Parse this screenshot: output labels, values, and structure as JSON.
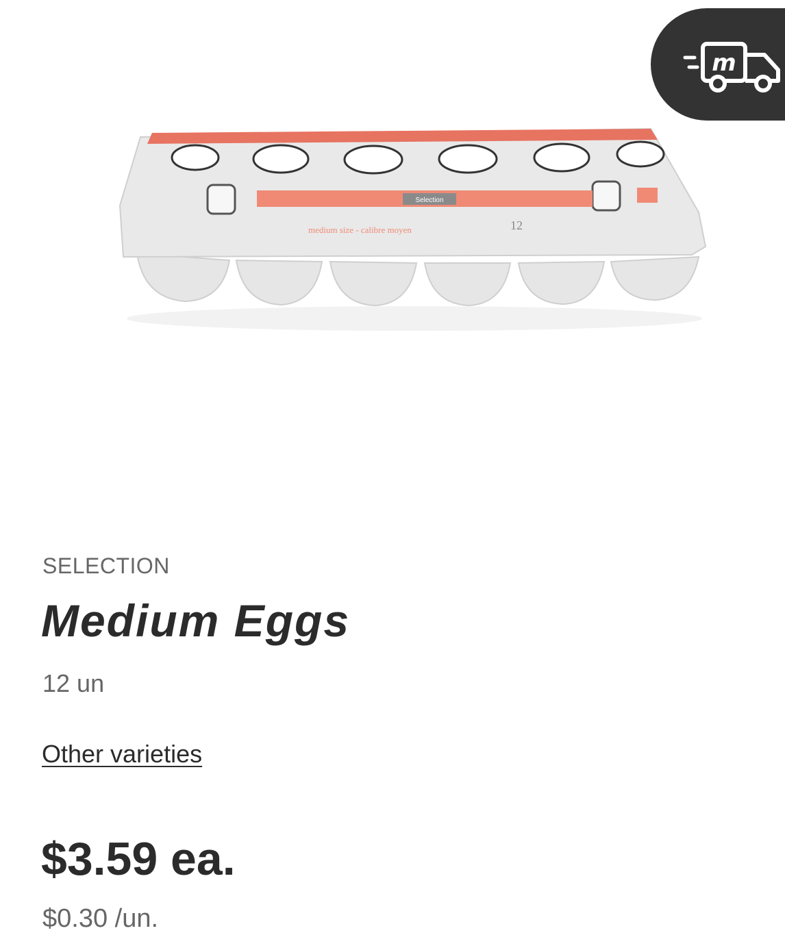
{
  "delivery_badge": {
    "icon": "delivery-truck-icon",
    "logo_letter": "m",
    "background_color": "#333333"
  },
  "product": {
    "image_icon": "egg-carton-image",
    "carton_brand_text": "Selection",
    "carton_size_text": "12",
    "carton_description_text": "medium size - calibre moyen",
    "brand": "SELECTION",
    "name": "Medium Eggs",
    "size": "12 un",
    "other_varieties_label": "Other varieties",
    "price": "$3.59 ea.",
    "unit_price": "$0.30 /un."
  },
  "colors": {
    "text_primary": "#2b2b2b",
    "text_secondary": "#666666",
    "carton_accent": "#f08a75"
  }
}
